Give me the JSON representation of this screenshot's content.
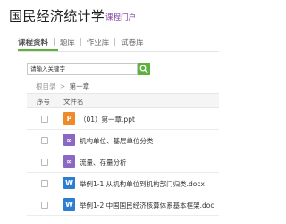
{
  "header": {
    "title": "国民经济统计学",
    "subtitle": "课程门户"
  },
  "tabs": [
    {
      "label": "课程资料",
      "active": true
    },
    {
      "label": "题库",
      "active": false
    },
    {
      "label": "作业库",
      "active": false
    },
    {
      "label": "试卷库",
      "active": false
    }
  ],
  "tab_separator": "|",
  "search": {
    "placeholder": "请输入关键字",
    "button_icon": "search-icon"
  },
  "breadcrumb": {
    "root": "根目录",
    "separator": ">",
    "current": "第一章"
  },
  "table": {
    "columns": [
      "序号",
      "文件名"
    ],
    "rows": [
      {
        "icon": "ppt-icon",
        "icon_glyph": "P",
        "name": "（01）第一章.ppt"
      },
      {
        "icon": "link-icon",
        "icon_glyph": "∞",
        "name": "机构单位、基层单位分类"
      },
      {
        "icon": "link-icon",
        "icon_glyph": "∞",
        "name": "流量、存量分析"
      },
      {
        "icon": "word-icon",
        "icon_glyph": "W",
        "name": "举例1-1 从机构单位到机构部门归类.docx"
      },
      {
        "icon": "word-icon",
        "icon_glyph": "W",
        "name": "举例1-2 中国国民经济核算体系基本框架.doc"
      }
    ]
  },
  "colors": {
    "accent": "#5db33a",
    "subtitle": "#7d3f9c",
    "ppt": "#ef8a2b",
    "link": "#8c68c5",
    "word": "#2c7fd0"
  }
}
